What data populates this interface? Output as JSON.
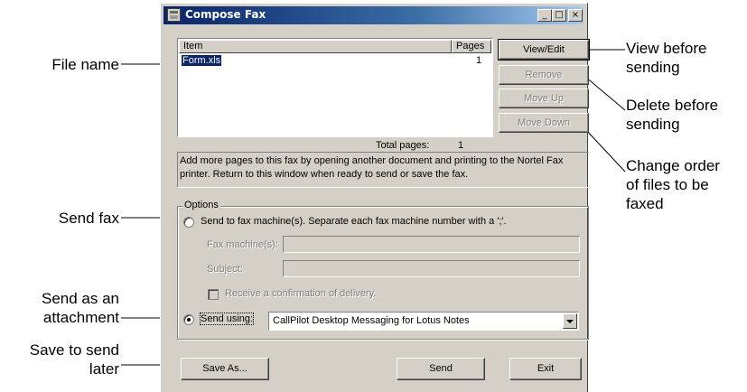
{
  "window": {
    "title": "Compose Fax",
    "minimize": "_",
    "maximize": "□",
    "close": "×"
  },
  "list": {
    "columns": [
      "Item",
      "Pages"
    ],
    "rows": [
      {
        "item": "Form.xls",
        "pages": "1"
      }
    ],
    "total_pages_label": "Total pages:",
    "total_pages_value": "1"
  },
  "buttons": {
    "view_edit": "View/Edit",
    "remove": "Remove",
    "move_up": "Move Up",
    "move_down": "Move Down",
    "save_as": "Save As...",
    "send": "Send",
    "exit": "Exit"
  },
  "info_text_line1": "Add more pages to this fax by opening another document and printing to the Nortel Fax",
  "info_text_line2": "printer.  Return to this window when ready to send or save the fax.",
  "options": {
    "group_label": "Options",
    "fax_machine_radio": "Send to fax machine(s). Separate each fax machine number with a ';'.",
    "fax_machine_label": "Fax machine(s):",
    "subject_label": "Subject:",
    "confirmation_label": "Receive a confirmation of delivery.",
    "send_using_label": "Send using:",
    "send_using_value": "CallPilot Desktop Messaging for Lotus Notes",
    "selected": "send_using"
  },
  "callouts": {
    "file_name": "File name",
    "send_fax": "Send fax",
    "send_attachment_1": "Send as an",
    "send_attachment_2": "attachment",
    "save_later_1": "Save to send",
    "save_later_2": "later",
    "view_before_1": "View before",
    "view_before_2": "sending",
    "delete_before_1": "Delete before",
    "delete_before_2": "sending",
    "change_order_1": "Change order",
    "change_order_2": "of files to be",
    "change_order_3": "faxed"
  }
}
